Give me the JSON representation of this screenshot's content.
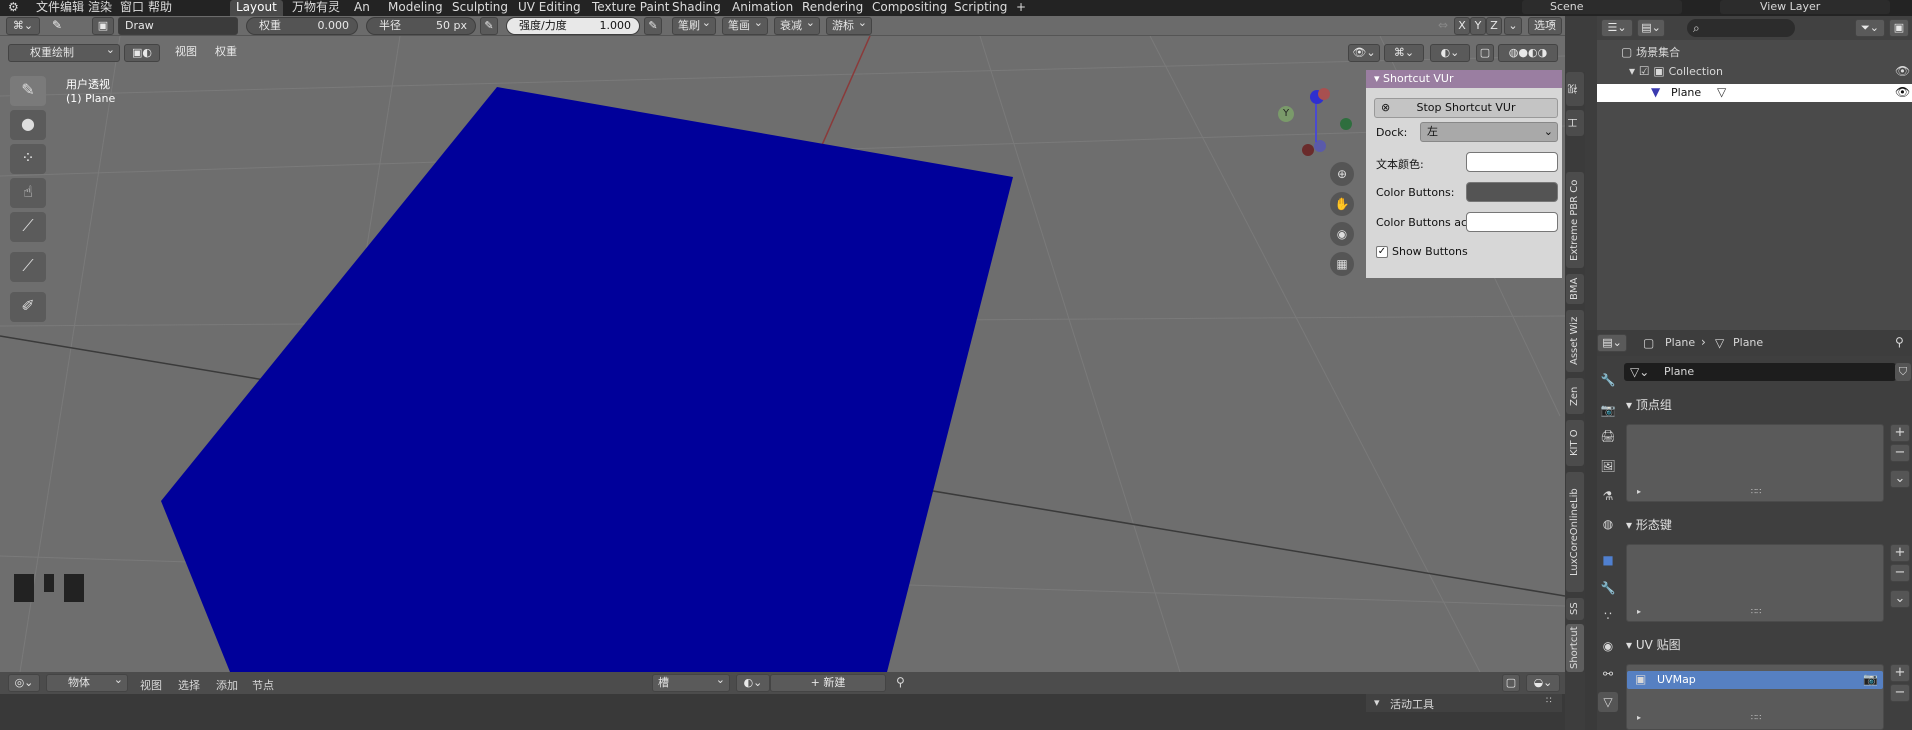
{
  "menu": {
    "file": "文件",
    "edit": "编辑",
    "render": "渲染",
    "window": "窗口",
    "help": "帮助"
  },
  "workspaces": [
    "Layout",
    "万物有灵",
    "An",
    "Modeling",
    "Sculpting",
    "UV Editing",
    "Texture Paint",
    "Shading",
    "Animation",
    "Rendering",
    "Compositing",
    "Scripting",
    "+"
  ],
  "scene": {
    "name": "Scene",
    "view_layer": "View Layer"
  },
  "tool_header": {
    "brush": "Draw",
    "weight_label": "权重",
    "weight_value": "0.000",
    "radius_label": "半径",
    "radius_value": "50 px",
    "strength_label": "强度/力度",
    "strength_value": "1.000",
    "brush_menu": "笔刷",
    "stroke_menu": "笔画",
    "falloff_menu": "衰减",
    "cursor_menu": "游标",
    "x": "X",
    "y": "Y",
    "z": "Z",
    "options": "选项"
  },
  "view_header": {
    "mode": "权重绘制",
    "view": "视图",
    "weights": "权重"
  },
  "viewport": {
    "view_name": "用户透视",
    "object_name": "(1) Plane",
    "plane_color": "#00009a",
    "bg_color": "#6e6e6e"
  },
  "gizmo": {
    "y": "Y"
  },
  "shortcut_panel": {
    "title": "Shortcut VUr",
    "stop_button": "Stop Shortcut VUr",
    "dock_label": "Dock:",
    "dock_value": "左",
    "text_color_label": "文本颜色:",
    "color_buttons_label": "Color Buttons:",
    "color_buttons_ac_label": "Color Buttons ac..",
    "show_buttons_label": "Show Buttons",
    "show_buttons_checked": true
  },
  "sidebar_tabs": [
    "Shortcut",
    "SS",
    "LuxCoreOnlineLib",
    "KIT O",
    "Zen",
    "Asset Wiz",
    "BMA",
    "Extreme PBR Co",
    "视",
    "工"
  ],
  "outliner": {
    "root": "场景集合",
    "collection": "Collection",
    "object": "Plane"
  },
  "properties": {
    "breadcrumb_obj": "Plane",
    "breadcrumb_data": "Plane",
    "mesh_name": "Plane",
    "vertex_groups": "顶点组",
    "shape_keys": "形态键",
    "uv_maps": "UV 贴图",
    "uv_map_item": "UVMap"
  },
  "bottom_header": {
    "object_mode": "物体",
    "view": "视图",
    "select": "选择",
    "add": "添加",
    "node": "节点",
    "slot": "槽",
    "new": "新建"
  },
  "bottom_panel": {
    "active_tool": "活动工具"
  }
}
